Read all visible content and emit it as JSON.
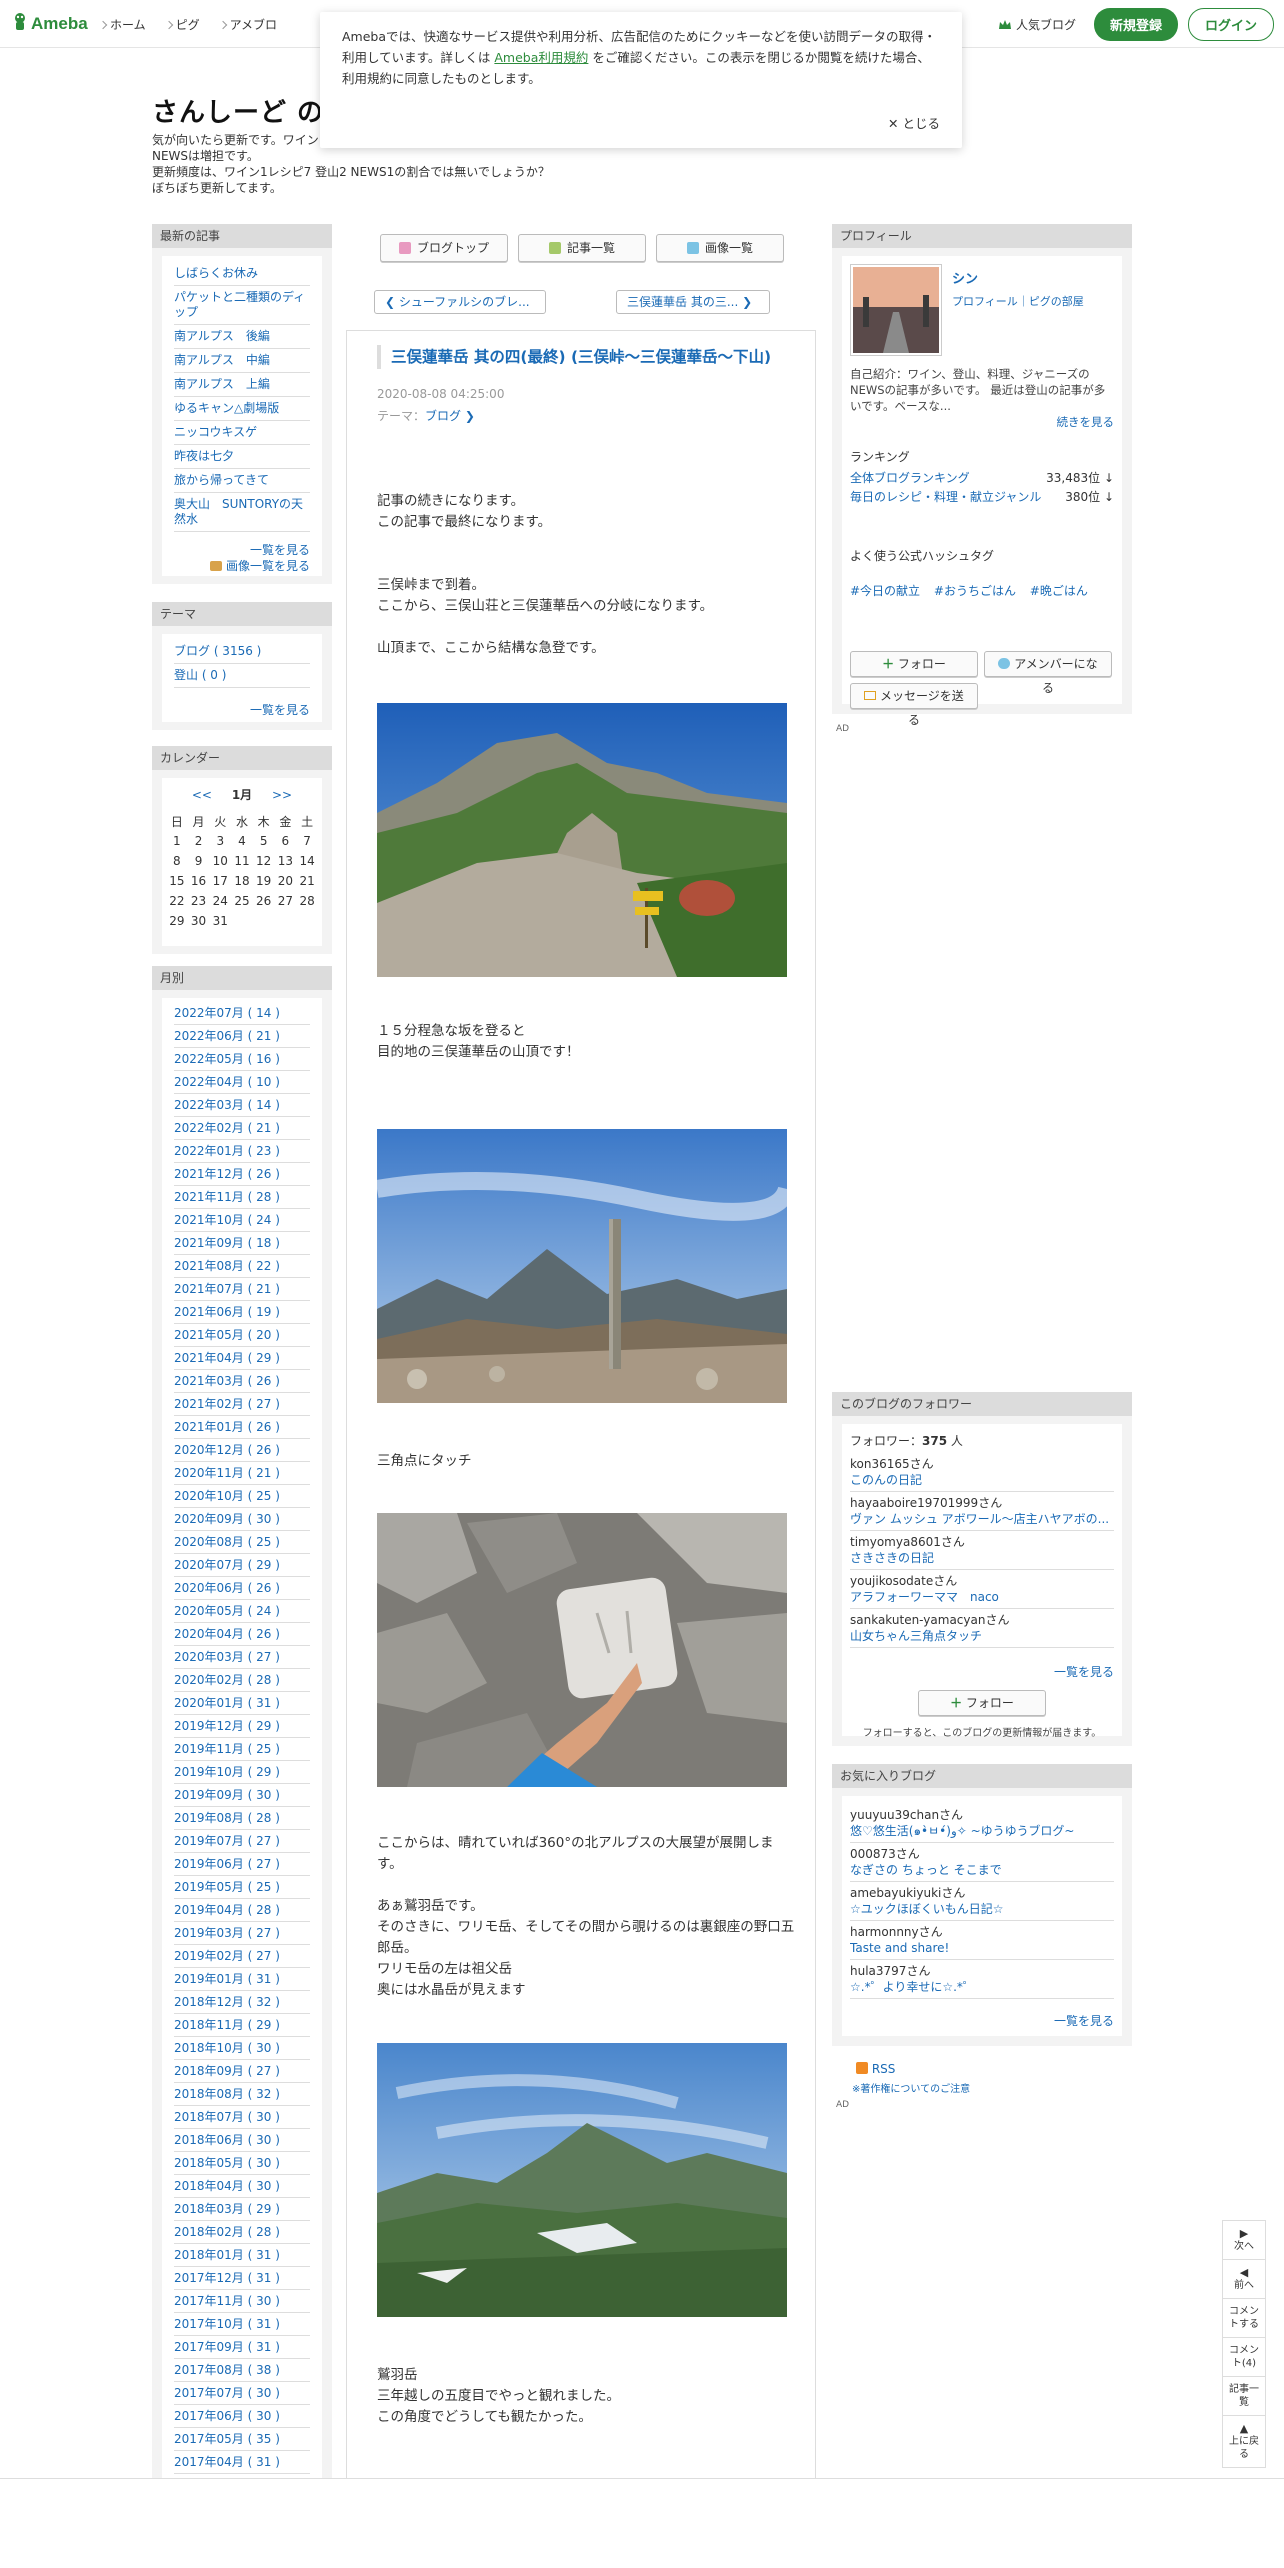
{
  "header": {
    "logo": "Ameba",
    "nav": [
      "ホーム",
      "ピグ",
      "アメブロ"
    ],
    "popular": "人気ブログ",
    "register": "新規登録",
    "login": "ログイン"
  },
  "cookie": {
    "text1": "Amebaでは、快適なサービス提供や利用分析、広告配信のためにクッキーなどを使い訪問データの取得・利用しています。詳しくは",
    "policy": "Ameba利用規約",
    "text2": "をご確認ください。この表示を閉じるか閲覧を続けた場合、利用規約に同意したものとします。",
    "close": "とじる"
  },
  "blog": {
    "title": "さんしーど のB",
    "desc1": "気が向いたら更新です。ワイン",
    "desc2": "NEWSは増担です。",
    "desc3": "更新頻度は、ワイン1レシピ7 登山2 NEWS1の割合では無いでしょうか？",
    "desc4": "ぼちぼち更新してます。"
  },
  "left": {
    "recent_head": "最新の記事",
    "recent": [
      "しばらくお休み",
      "パケットと二種類のディップ",
      "南アルプス　後編",
      "南アルプス　中編",
      "南アルプス　上編",
      "ゆるキャン△劇場版",
      "ニッコウキスゲ",
      "昨夜は七夕",
      "旅から帰ってきて",
      "奥大山　SUNTORYの天然水"
    ],
    "recent_more": "一覧を見る",
    "recent_images": "画像一覧を見る",
    "theme_head": "テーマ",
    "themes": [
      "ブログ ( 3156 )",
      "登山 ( 0 )"
    ],
    "theme_more": "一覧を見る",
    "cal_head": "カレンダー",
    "cal_prev": "<<",
    "cal_month": "1月",
    "cal_next": ">>",
    "cal_days": [
      "日",
      "月",
      "火",
      "水",
      "木",
      "金",
      "土"
    ],
    "cal_weeks": [
      [
        "1",
        "2",
        "3",
        "4",
        "5",
        "6",
        "7"
      ],
      [
        "8",
        "9",
        "10",
        "11",
        "12",
        "13",
        "14"
      ],
      [
        "15",
        "16",
        "17",
        "18",
        "19",
        "20",
        "21"
      ],
      [
        "22",
        "23",
        "24",
        "25",
        "26",
        "27",
        "28"
      ],
      [
        "29",
        "30",
        "31",
        "",
        "",
        "",
        ""
      ]
    ],
    "month_head": "月別",
    "months": [
      "2022年07月 ( 14 )",
      "2022年06月 ( 21 )",
      "2022年05月 ( 16 )",
      "2022年04月 ( 10 )",
      "2022年03月 ( 14 )",
      "2022年02月 ( 21 )",
      "2022年01月 ( 23 )",
      "2021年12月 ( 26 )",
      "2021年11月 ( 28 )",
      "2021年10月 ( 24 )",
      "2021年09月 ( 18 )",
      "2021年08月 ( 22 )",
      "2021年07月 ( 21 )",
      "2021年06月 ( 19 )",
      "2021年05月 ( 20 )",
      "2021年04月 ( 29 )",
      "2021年03月 ( 26 )",
      "2021年02月 ( 27 )",
      "2021年01月 ( 26 )",
      "2020年12月 ( 26 )",
      "2020年11月 ( 21 )",
      "2020年10月 ( 25 )",
      "2020年09月 ( 30 )",
      "2020年08月 ( 25 )",
      "2020年07月 ( 29 )",
      "2020年06月 ( 26 )",
      "2020年05月 ( 24 )",
      "2020年04月 ( 26 )",
      "2020年03月 ( 27 )",
      "2020年02月 ( 28 )",
      "2020年01月 ( 31 )",
      "2019年12月 ( 29 )",
      "2019年11月 ( 25 )",
      "2019年10月 ( 29 )",
      "2019年09月 ( 30 )",
      "2019年08月 ( 28 )",
      "2019年07月 ( 27 )",
      "2019年06月 ( 27 )",
      "2019年05月 ( 25 )",
      "2019年04月 ( 28 )",
      "2019年03月 ( 27 )",
      "2019年02月 ( 27 )",
      "2019年01月 ( 31 )",
      "2018年12月 ( 32 )",
      "2018年11月 ( 29 )",
      "2018年10月 ( 30 )",
      "2018年09月 ( 27 )",
      "2018年08月 ( 32 )",
      "2018年07月 ( 30 )",
      "2018年06月 ( 30 )",
      "2018年05月 ( 30 )",
      "2018年04月 ( 30 )",
      "2018年03月 ( 29 )",
      "2018年02月 ( 28 )",
      "2018年01月 ( 31 )",
      "2017年12月 ( 31 )",
      "2017年11月 ( 30 )",
      "2017年10月 ( 31 )",
      "2017年09月 ( 31 )",
      "2017年08月 ( 38 )",
      "2017年07月 ( 30 )",
      "2017年06月 ( 30 )",
      "2017年05月 ( 35 )",
      "2017年04月 ( 31 )"
    ]
  },
  "toolbar": {
    "blogtop": "ブログトップ",
    "entries": "記事一覧",
    "images": "画像一覧",
    "prev": "シューファルシのブレ...",
    "next": "三俣蓮華岳 其の三..."
  },
  "article": {
    "title": "三俣蓮華岳 其の四(最終) (三俣峠～三俣蓮華岳～下山)",
    "date": "2020-08-08 04:25:00",
    "theme_label": "テーマ：",
    "theme": "ブログ",
    "p1": "記事の続きになります。\nこの記事で最終になります。",
    "p2": "三俣峠まで到着。\nここから、三俣山荘と三俣蓮華岳への分岐になります。\n\n山頂まで、ここから結構な急登です。",
    "p3": "１５分程急な坂を登ると\n目的地の三俣蓮華岳の山頂です！",
    "p4": "三角点にタッチ",
    "p5": "ここからは、晴れていれば360°の北アルプスの大展望が展開します。\n\nあぁ鷲羽岳です。\nそのさきに、ワリモ岳、そしてその間から覗けるのは裏銀座の野口五郎岳。\nワリモ岳の左は祖父岳\n奥には水晶岳が見えます",
    "p6": "鷲羽岳\n三年越しの五度目でやっと観れました。\nこの角度でどうしても観たかった。"
  },
  "right": {
    "profile_head": "プロフィール",
    "name": "シン",
    "links": "プロフィール｜ピグの部屋",
    "intro": "自己紹介：ワイン、登山、料理、ジャニーズのNEWSの記事が多いです。 最近は登山の記事が多いです。ベースな...",
    "intro_more": "続きを見る",
    "ranking_label": "ランキング",
    "rank1_name": "全体ブログランキング",
    "rank1_val": "33,483位 ↓",
    "rank2_name": "毎日のレシピ・料理・献立ジャンル",
    "rank2_val": "380位 ↓",
    "hashtag_label": "よく使う公式ハッシュタグ",
    "tags": [
      "#今日の献立",
      "#おうちごはん",
      "#晩ごはん"
    ],
    "follow_btn": "フォロー",
    "member_btn": "アメンバーになる",
    "message_btn": "メッセージを送る",
    "ad1": "AD",
    "followers_head": "このブログのフォロワー",
    "follower_label": "フォロワー：",
    "follower_count": "375",
    "follower_unit": "人",
    "followers": [
      {
        "user": "kon36165さん",
        "blog": "このんの日記"
      },
      {
        "user": "hayaaboire19701999さん",
        "blog": "ヴァン ムッシュ アボワール〜店主ハヤアボの..."
      },
      {
        "user": "timyomya8601さん",
        "blog": "さきさきの日記"
      },
      {
        "user": "youjikosodateさん",
        "blog": "アラフォーワーママ　naco"
      },
      {
        "user": "sankakuten-yamacyanさん",
        "blog": "山女ちゃん三角点タッチ"
      }
    ],
    "followers_more": "一覧を見る",
    "follow_btn2": "フォロー",
    "follow_note": "フォローすると、このブログの更新情報が届きます。",
    "fav_head": "お気に入りブログ",
    "favs": [
      {
        "user": "yuuyuu39chanさん",
        "blog": "悠♡悠生活(๑•̀ㅂ•́)و✧ ~ゆうゆうブログ~"
      },
      {
        "user": "000873さん",
        "blog": "なぎさの ちょっと そこまで"
      },
      {
        "user": "amebayukiyukiさん",
        "blog": "☆ユックほぼくいもん日記☆"
      },
      {
        "user": "harmonnnyさん",
        "blog": "Taste and share!"
      },
      {
        "user": "hula3797さん",
        "blog": "☆.*゜より幸せに☆.*゜"
      }
    ],
    "fav_more": "一覧を見る",
    "rss": "RSS",
    "copyright": "※著作権についてのご注意",
    "ad2": "AD"
  },
  "floatnav": {
    "next": "次へ",
    "prev": "前へ",
    "comment_write": "コメントする",
    "comment_count": "コメント(4)",
    "list": "記事一覧",
    "top": "上に戻る"
  }
}
